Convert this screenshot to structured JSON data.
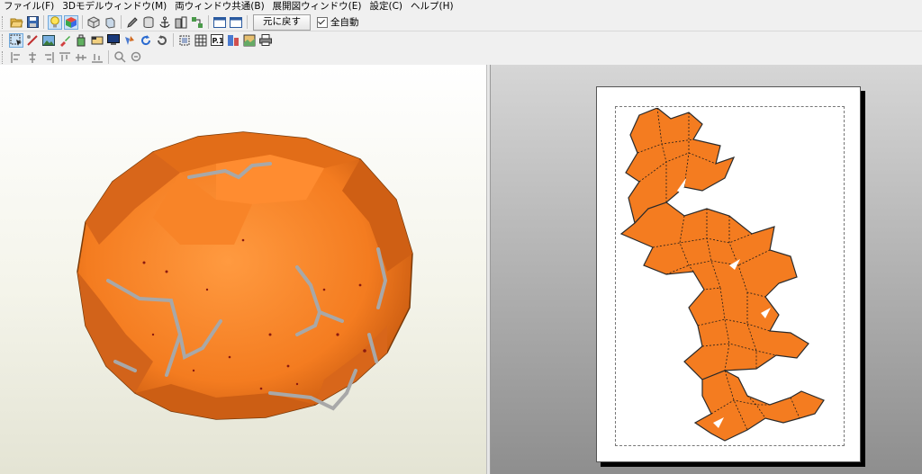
{
  "menubar": {
    "items": [
      "ファイル(F)",
      "3Dモデルウィンドウ(M)",
      "両ウィンドウ共通(B)",
      "展開図ウィンドウ(E)",
      "設定(C)",
      "ヘルプ(H)"
    ]
  },
  "toolbar": {
    "reset_label": "元に戻す",
    "auto_all_label": "全自動",
    "auto_all_checked": true
  },
  "colors": {
    "model_orange": "#f47c20",
    "model_dark": "#c85a10",
    "unfold_orange": "#f47c20",
    "fold_line": "#1a1a1a"
  }
}
